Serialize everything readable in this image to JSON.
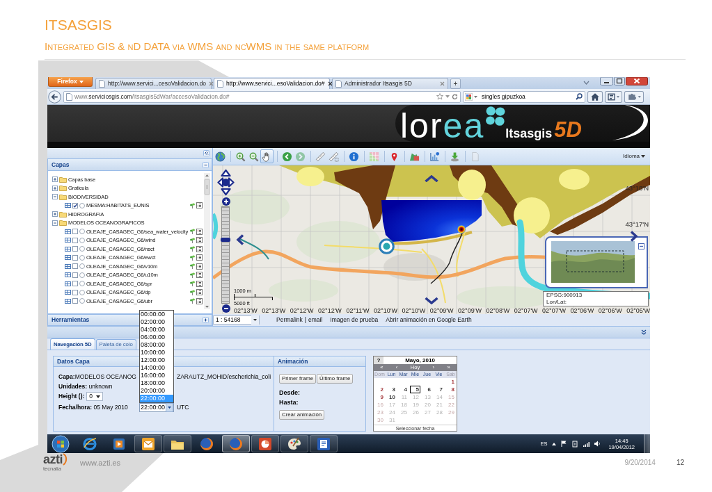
{
  "slide": {
    "title": "ITSASGIS",
    "subtitle": "Integrated GIS & nD DATA via WMS and ncWMS in the same platform"
  },
  "browser": {
    "menu_button": "Firefox",
    "tabs": [
      {
        "label": "http://www.servici...cesoValidacion.do",
        "selected": false
      },
      {
        "label": "http://www.servici...esoValidacion.do#",
        "selected": true
      },
      {
        "label": "Administrador Itsasgis 5D",
        "selected": false
      }
    ],
    "new_tab": "+",
    "address": {
      "prefix": "www.",
      "host": "serviciosgis.com",
      "path": "/itsasgis5dWar/accesoValidacion.do#"
    },
    "search_value": "singles gipuzkoa"
  },
  "banner": {
    "logo_parts": [
      {
        "text": "lor",
        "color": "#ffffff"
      },
      {
        "text": "ea",
        "color": "#63d3dc"
      }
    ],
    "product": "Itsasgis",
    "version": "5D"
  },
  "layers_panel": {
    "title": "Capas",
    "tree": [
      {
        "label": "Capas base",
        "expanded": false
      },
      {
        "label": "Graticula",
        "expanded": false
      },
      {
        "label": "BIODIVERSIDAD",
        "expanded": true,
        "children": [
          {
            "label": "MESMA:HABITATS_EUNIS",
            "checked": true,
            "selected": false
          }
        ]
      },
      {
        "label": "HIDROGRAFIA",
        "expanded": false
      },
      {
        "label": "MODELOS OCEANOGRAFICOS",
        "expanded": true,
        "children": [
          {
            "label": "OLEAJE_CASAGEC_G6/sea_water_velocity",
            "checked": false,
            "selected": false
          },
          {
            "label": "OLEAJE_CASAGEC_G6/wind",
            "checked": false,
            "selected": false
          },
          {
            "label": "OLEAJE_CASAGEC_G6/nsct",
            "checked": false,
            "selected": false
          },
          {
            "label": "OLEAJE_CASAGEC_G6/ewct",
            "checked": false,
            "selected": false
          },
          {
            "label": "OLEAJE_CASAGEC_G6/v10m",
            "checked": false,
            "selected": false
          },
          {
            "label": "OLEAJE_CASAGEC_G6/u10m",
            "checked": false,
            "selected": false
          },
          {
            "label": "OLEAJE_CASAGEC_G6/spr",
            "checked": false,
            "selected": false
          },
          {
            "label": "OLEAJE_CASAGEC_G6/dp",
            "checked": false,
            "selected": false
          },
          {
            "label": "OLEAJE_CASAGEC_G6/ubr",
            "checked": false,
            "selected": false
          }
        ]
      }
    ],
    "tools_title": "Herramientas"
  },
  "map": {
    "toolbar": [
      {
        "kind": "globe",
        "selected": false,
        "disabled": false
      },
      {
        "kind": "zoom-in",
        "selected": false,
        "disabled": false
      },
      {
        "kind": "zoom-out",
        "selected": false,
        "disabled": false
      },
      {
        "kind": "pan",
        "selected": true,
        "disabled": false
      },
      {
        "kind": "back",
        "selected": false,
        "disabled": false
      },
      {
        "kind": "forward",
        "selected": false,
        "disabled": true
      },
      {
        "kind": "measure-length",
        "selected": false,
        "disabled": false
      },
      {
        "kind": "measure-area",
        "selected": false,
        "disabled": false
      },
      {
        "kind": "info",
        "selected": false,
        "disabled": false
      },
      {
        "kind": "grid",
        "selected": false,
        "disabled": false
      },
      {
        "kind": "pin",
        "selected": false,
        "disabled": false
      },
      {
        "kind": "layers",
        "selected": false,
        "disabled": false
      },
      {
        "kind": "chart",
        "selected": false,
        "disabled": false
      },
      {
        "kind": "download",
        "selected": false,
        "disabled": false
      },
      {
        "kind": "print",
        "selected": false,
        "disabled": true
      }
    ],
    "language_menu": "Idioma",
    "zoom": {
      "level": 0.66
    },
    "scale": {
      "metric": "1000 m",
      "imperial": "5000 ft"
    },
    "lat_labels": [
      "43°18'N",
      "43°17'N"
    ],
    "lon_labels": [
      "02°13'W",
      "02°13'W",
      "02°12'W",
      "02°12'W",
      "02°11'W",
      "02°10'W",
      "02°10'W",
      "02°09'W",
      "02°09'W",
      "02°08'W",
      "02°07'W",
      "02°07'W",
      "02°06'W",
      "02°06'W",
      "02°05'W"
    ],
    "overview": {
      "projection": "EPSG:900913",
      "coords_label": "Lon/Lat:"
    },
    "scale_select": "1 : 54168",
    "links": [
      "Permalink",
      "email",
      "Imagen de prueba",
      "Abrir animación en Google Earth"
    ],
    "link_separator": "|"
  },
  "bottom_tabs": [
    {
      "label": "Navegación 5D",
      "selected": true
    },
    {
      "label": "Paleta de colo",
      "selected": false
    }
  ],
  "layer_info": {
    "title": "Datos Capa",
    "layer": "**Capa:**MODELOS OCEANOG",
    "layer_rest": "ZARAUTZ_MOHID/escherichia_coli",
    "units": "**Unidades:** unknown",
    "height_label": "Height ():",
    "height_value": "0",
    "datetime": "**Fecha/hora:** 05 May 2010",
    "time_value": "22:00:00",
    "timezone": "UTC",
    "time_options": [
      {
        "label": "00:00:00",
        "selected": false
      },
      {
        "label": "02:00:00",
        "selected": false
      },
      {
        "label": "04:00:00",
        "selected": false
      },
      {
        "label": "06:00:00",
        "selected": false
      },
      {
        "label": "08:00:00",
        "selected": false
      },
      {
        "label": "10:00:00",
        "selected": false
      },
      {
        "label": "12:00:00",
        "selected": false
      },
      {
        "label": "14:00:00",
        "selected": false
      },
      {
        "label": "16:00:00",
        "selected": false
      },
      {
        "label": "18:00:00",
        "selected": false
      },
      {
        "label": "20:00:00",
        "selected": false
      },
      {
        "label": "22:00:00",
        "selected": true
      }
    ]
  },
  "animation": {
    "title": "Animación",
    "first_frame": "Primer frame",
    "last_frame": "Último frame",
    "from_label": "Desde:",
    "to_label": "Hasta:",
    "create": "Crear animación"
  },
  "calendar": {
    "help": "?",
    "title": "Mayo, 2010",
    "nav": [
      "«",
      "‹",
      "Hoy",
      "›",
      "»"
    ],
    "weekdays": [
      {
        "label": "Dom",
        "weekend": true
      },
      {
        "label": "Lun",
        "weekend": false
      },
      {
        "label": "Mar",
        "weekend": false
      },
      {
        "label": "Mie",
        "weekend": false
      },
      {
        "label": "Jue",
        "weekend": false
      },
      {
        "label": "Vie",
        "weekend": false
      },
      {
        "label": "Sab",
        "weekend": true
      }
    ],
    "weeks": [
      [
        {
          "day": "1",
          "weekend": true,
          "disabled": false,
          "selected": false
        }
      ],
      [
        {
          "day": "2",
          "weekend": true,
          "disabled": false,
          "selected": false
        },
        {
          "day": "3",
          "weekend": false,
          "disabled": false,
          "selected": false
        },
        {
          "day": "4",
          "weekend": false,
          "disabled": false,
          "selected": false
        },
        {
          "day": "5",
          "weekend": false,
          "disabled": false,
          "selected": true
        },
        {
          "day": "6",
          "weekend": false,
          "disabled": false,
          "selected": false
        },
        {
          "day": "7",
          "weekend": false,
          "disabled": false,
          "selected": false
        },
        {
          "day": "8",
          "weekend": true,
          "disabled": false,
          "selected": false
        }
      ],
      [
        {
          "day": "9",
          "weekend": true,
          "disabled": false,
          "selected": false
        },
        {
          "day": "10",
          "weekend": false,
          "disabled": false,
          "selected": false
        },
        {
          "day": "11",
          "weekend": false,
          "disabled": true,
          "selected": false
        },
        {
          "day": "12",
          "weekend": false,
          "disabled": true,
          "selected": false
        },
        {
          "day": "13",
          "weekend": false,
          "disabled": true,
          "selected": false
        },
        {
          "day": "14",
          "weekend": false,
          "disabled": true,
          "selected": false
        },
        {
          "day": "15",
          "weekend": true,
          "disabled": true,
          "selected": false
        }
      ],
      [
        {
          "day": "16",
          "weekend": true,
          "disabled": true,
          "selected": false
        },
        {
          "day": "17",
          "weekend": false,
          "disabled": true,
          "selected": false
        },
        {
          "day": "18",
          "weekend": false,
          "disabled": true,
          "selected": false
        },
        {
          "day": "19",
          "weekend": false,
          "disabled": true,
          "selected": false
        },
        {
          "day": "20",
          "weekend": false,
          "disabled": true,
          "selected": false
        },
        {
          "day": "21",
          "weekend": false,
          "disabled": true,
          "selected": false
        },
        {
          "day": "22",
          "weekend": true,
          "disabled": true,
          "selected": false
        }
      ],
      [
        {
          "day": "23",
          "weekend": true,
          "disabled": true,
          "selected": false
        },
        {
          "day": "24",
          "weekend": false,
          "disabled": true,
          "selected": false
        },
        {
          "day": "25",
          "weekend": false,
          "disabled": true,
          "selected": false
        },
        {
          "day": "26",
          "weekend": false,
          "disabled": true,
          "selected": false
        },
        {
          "day": "27",
          "weekend": false,
          "disabled": true,
          "selected": false
        },
        {
          "day": "28",
          "weekend": false,
          "disabled": true,
          "selected": false
        },
        {
          "day": "29",
          "weekend": true,
          "disabled": true,
          "selected": false
        }
      ],
      [
        {
          "day": "30",
          "weekend": true,
          "disabled": true,
          "selected": false
        },
        {
          "day": "31",
          "weekend": false,
          "disabled": true,
          "selected": false
        }
      ]
    ],
    "footer": "Seleccionar fecha"
  },
  "taskbar": {
    "apps": [
      {
        "kind": "ie",
        "running": false,
        "active": false
      },
      {
        "kind": "media",
        "running": false,
        "active": false
      },
      {
        "kind": "outlook",
        "running": true,
        "active": false
      },
      {
        "kind": "explorer",
        "running": true,
        "active": false
      },
      {
        "kind": "firefox",
        "running": false,
        "active": false
      },
      {
        "kind": "firefox",
        "running": true,
        "active": true
      },
      {
        "kind": "powerpoint",
        "running": true,
        "active": false
      },
      {
        "kind": "paint",
        "running": true,
        "active": false
      },
      {
        "kind": "word",
        "running": true,
        "active": false
      }
    ],
    "language": "ES",
    "time": "14:45",
    "date": "19/04/2012"
  },
  "footer": {
    "logo": "azti",
    "logo_sub": "tecnalia",
    "url": "www.azti.es",
    "date": "9/20/2014",
    "page": "12"
  }
}
